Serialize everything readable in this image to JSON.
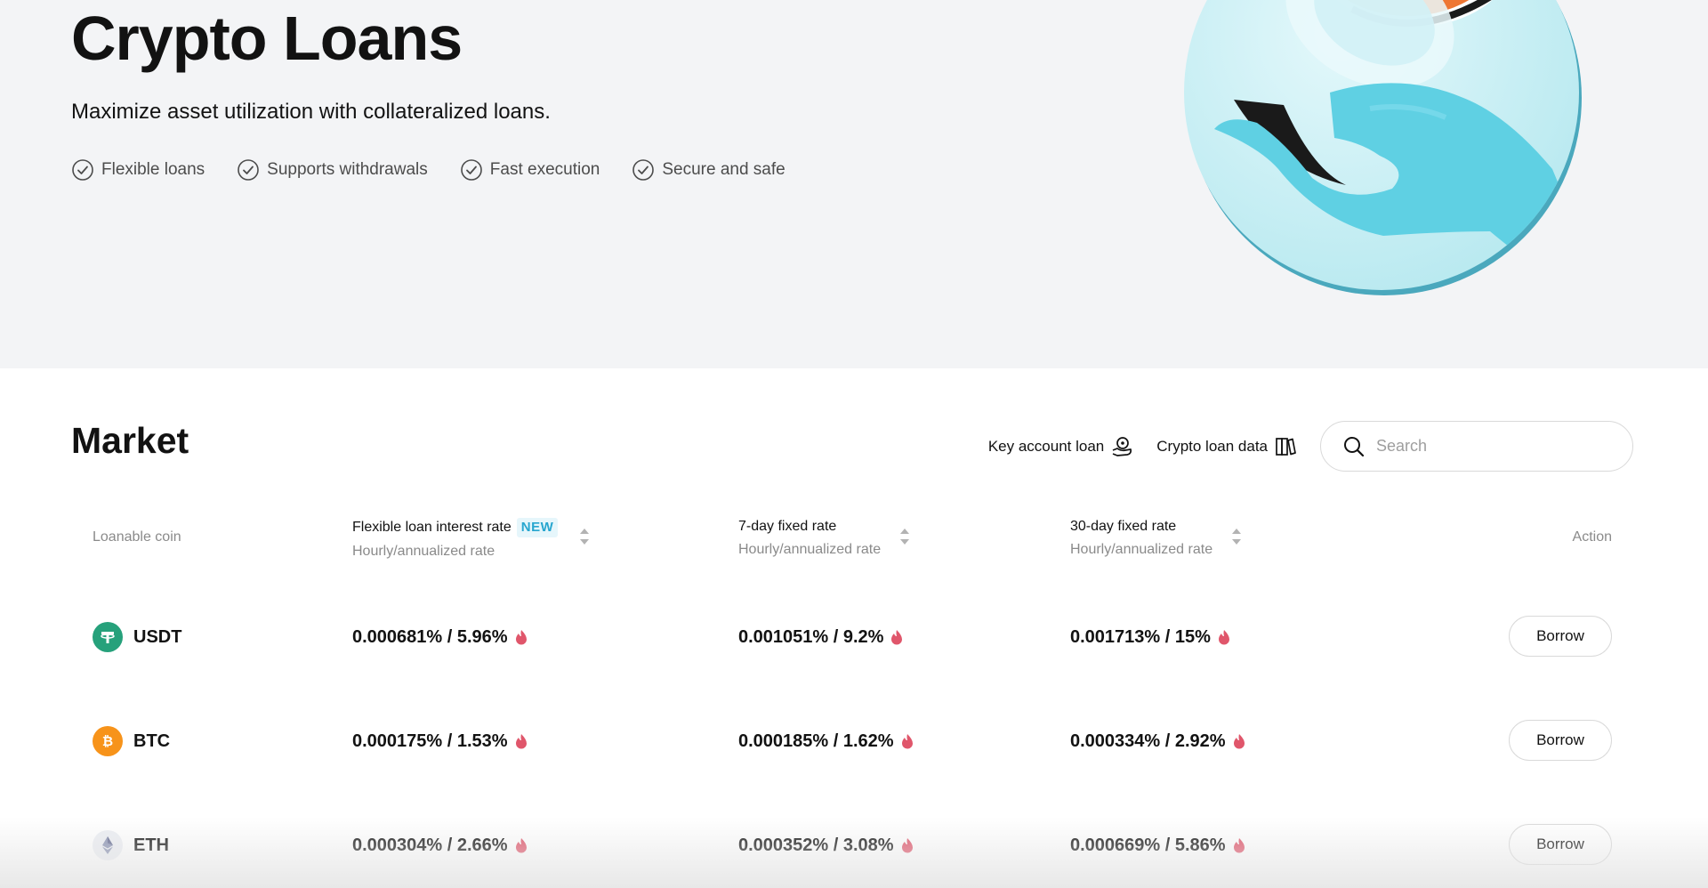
{
  "hero": {
    "title": "Crypto Loans",
    "subtitle": "Maximize asset utilization with collateralized loans.",
    "features": [
      "Flexible loans",
      "Supports withdrawals",
      "Fast execution",
      "Secure and safe"
    ]
  },
  "market": {
    "title": "Market",
    "key_account_loan": "Key account loan",
    "crypto_loan_data": "Crypto loan data",
    "search_placeholder": "Search"
  },
  "table": {
    "headers": {
      "coin": "Loanable coin",
      "flexible": "Flexible loan interest rate",
      "flexible_badge": "NEW",
      "seven_day": "7-day fixed rate",
      "thirty_day": "30-day fixed rate",
      "sub": "Hourly/annualized rate",
      "action": "Action"
    },
    "rows": [
      {
        "coin": "USDT",
        "icon": "tether-icon",
        "flexible": "0.000681% / 5.96%",
        "seven_day": "0.001051% / 9.2%",
        "thirty_day": "0.001713% / 15%",
        "action": "Borrow"
      },
      {
        "coin": "BTC",
        "icon": "bitcoin-icon",
        "flexible": "0.000175% / 1.53%",
        "seven_day": "0.000185% / 1.62%",
        "thirty_day": "0.000334% / 2.92%",
        "action": "Borrow"
      },
      {
        "coin": "ETH",
        "icon": "ethereum-icon",
        "flexible": "0.000304% / 2.66%",
        "seven_day": "0.000352% / 3.08%",
        "thirty_day": "0.000669% / 5.86%",
        "action": "Borrow"
      }
    ]
  },
  "colors": {
    "hero_bg": "#f3f4f6",
    "badge_text": "#27a6cf",
    "flame": "#e0566b",
    "usdt": "#26a17b",
    "btc": "#f7931a"
  }
}
